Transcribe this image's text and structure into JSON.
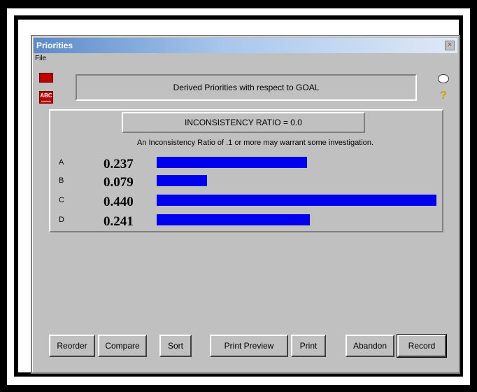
{
  "window": {
    "title": "Priorities",
    "close_glyph": "×"
  },
  "menu": {
    "file": "File"
  },
  "icons": {
    "abc_label": "ABC"
  },
  "header": {
    "title": "Derived Priorities with respect to GOAL"
  },
  "inconsistency": {
    "ratio_label": "INCONSISTENCY RATIO = 0.0",
    "note": "An Inconsistency Ratio of .1 or more may warrant some investigation."
  },
  "priorities": [
    {
      "label": "A",
      "value": "0.237",
      "weight": 0.237
    },
    {
      "label": "B",
      "value": "0.079",
      "weight": 0.079
    },
    {
      "label": "C",
      "value": "0.440",
      "weight": 0.44
    },
    {
      "label": "D",
      "value": "0.241",
      "weight": 0.241
    }
  ],
  "buttons": {
    "reorder": "Reorder",
    "compare": "Compare",
    "sort": "Sort",
    "print_preview": "Print Preview",
    "print": "Print",
    "abandon": "Abandon",
    "record": "Record"
  },
  "colors": {
    "bar": "#0000ee",
    "window_bg": "#c0c0c0",
    "title_gradient_start": "#5b8ac8"
  }
}
